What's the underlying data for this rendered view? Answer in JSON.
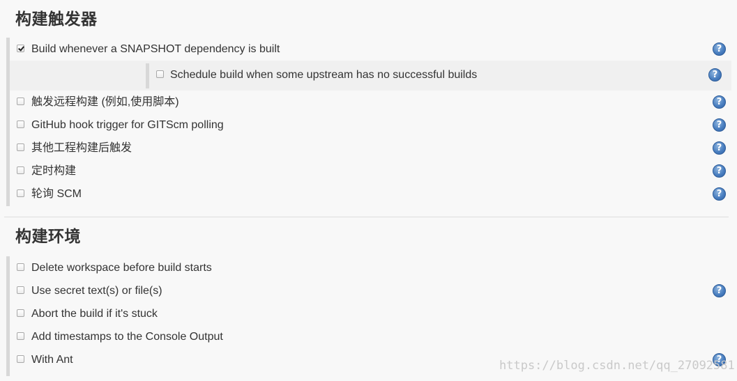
{
  "triggers": {
    "title": "构建触发器",
    "items": [
      {
        "label": "Build whenever a SNAPSHOT dependency is built",
        "checked": true,
        "help": true
      },
      {
        "label": "触发远程构建 (例如,使用脚本)",
        "checked": false,
        "help": true
      },
      {
        "label": "GitHub hook trigger for GITScm polling",
        "checked": false,
        "help": true
      },
      {
        "label": "其他工程构建后触发",
        "checked": false,
        "help": true
      },
      {
        "label": "定时构建",
        "checked": false,
        "help": true
      },
      {
        "label": "轮询 SCM",
        "checked": false,
        "help": true
      }
    ],
    "nested": {
      "label": "Schedule build when some upstream has no successful builds",
      "checked": false,
      "help": true
    }
  },
  "environment": {
    "title": "构建环境",
    "items": [
      {
        "label": "Delete workspace before build starts",
        "checked": false,
        "help": false
      },
      {
        "label": "Use secret text(s) or file(s)",
        "checked": false,
        "help": true
      },
      {
        "label": "Abort the build if it's stuck",
        "checked": false,
        "help": false
      },
      {
        "label": "Add timestamps to the Console Output",
        "checked": false,
        "help": false
      },
      {
        "label": "With Ant",
        "checked": false,
        "help": true
      }
    ]
  },
  "help_icon": {
    "glyph": "?",
    "name": "help-icon",
    "color": "#4a7fc0"
  },
  "watermark": "https://blog.csdn.net/qq_27092581"
}
